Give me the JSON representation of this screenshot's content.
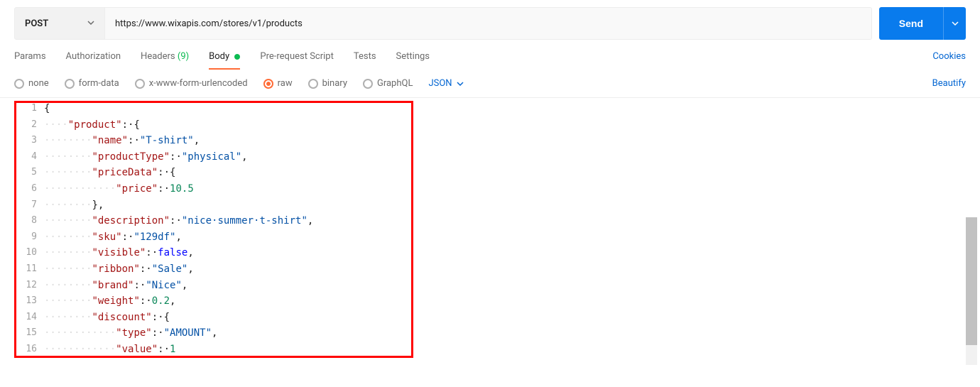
{
  "request": {
    "method": "POST",
    "url": "https://www.wixapis.com/stores/v1/products",
    "send_label": "Send"
  },
  "tabs": {
    "params": "Params",
    "authorization": "Authorization",
    "headers_label": "Headers",
    "headers_count": "(9)",
    "body": "Body",
    "prerequest": "Pre-request Script",
    "tests": "Tests",
    "settings": "Settings",
    "cookies": "Cookies"
  },
  "body_types": {
    "none": "none",
    "formdata": "form-data",
    "urlencoded": "x-www-form-urlencoded",
    "raw": "raw",
    "binary": "binary",
    "graphql": "GraphQL",
    "json": "JSON",
    "beautify": "Beautify"
  },
  "code": {
    "lines": [
      {
        "n": "1",
        "tokens": [
          {
            "t": "punct",
            "v": "{"
          }
        ]
      },
      {
        "n": "2",
        "tokens": [
          {
            "t": "guide",
            "v": "····"
          },
          {
            "t": "key",
            "v": "\"product\""
          },
          {
            "t": "punct",
            "v": ":·"
          },
          {
            "t": "punct",
            "v": "{"
          }
        ]
      },
      {
        "n": "3",
        "tokens": [
          {
            "t": "guide",
            "v": "········"
          },
          {
            "t": "key",
            "v": "\"name\""
          },
          {
            "t": "punct",
            "v": ":·"
          },
          {
            "t": "str",
            "v": "\"T-shirt\""
          },
          {
            "t": "punct",
            "v": ","
          }
        ]
      },
      {
        "n": "4",
        "tokens": [
          {
            "t": "guide",
            "v": "········"
          },
          {
            "t": "key",
            "v": "\"productType\""
          },
          {
            "t": "punct",
            "v": ":·"
          },
          {
            "t": "str",
            "v": "\"physical\""
          },
          {
            "t": "punct",
            "v": ","
          }
        ]
      },
      {
        "n": "5",
        "tokens": [
          {
            "t": "guide",
            "v": "········"
          },
          {
            "t": "key",
            "v": "\"priceData\""
          },
          {
            "t": "punct",
            "v": ":·"
          },
          {
            "t": "punct",
            "v": "{"
          }
        ]
      },
      {
        "n": "6",
        "tokens": [
          {
            "t": "guide",
            "v": "············"
          },
          {
            "t": "key",
            "v": "\"price\""
          },
          {
            "t": "punct",
            "v": ":·"
          },
          {
            "t": "num",
            "v": "10.5"
          }
        ]
      },
      {
        "n": "7",
        "tokens": [
          {
            "t": "guide",
            "v": "········"
          },
          {
            "t": "punct",
            "v": "},"
          }
        ]
      },
      {
        "n": "8",
        "tokens": [
          {
            "t": "guide",
            "v": "········"
          },
          {
            "t": "key",
            "v": "\"description\""
          },
          {
            "t": "punct",
            "v": ":·"
          },
          {
            "t": "str",
            "v": "\"nice·summer·t-shirt\""
          },
          {
            "t": "punct",
            "v": ","
          }
        ]
      },
      {
        "n": "9",
        "tokens": [
          {
            "t": "guide",
            "v": "········"
          },
          {
            "t": "key",
            "v": "\"sku\""
          },
          {
            "t": "punct",
            "v": ":·"
          },
          {
            "t": "str",
            "v": "\"129df\""
          },
          {
            "t": "punct",
            "v": ","
          }
        ]
      },
      {
        "n": "10",
        "tokens": [
          {
            "t": "guide",
            "v": "········"
          },
          {
            "t": "key",
            "v": "\"visible\""
          },
          {
            "t": "punct",
            "v": ":·"
          },
          {
            "t": "kw",
            "v": "false"
          },
          {
            "t": "punct",
            "v": ","
          }
        ]
      },
      {
        "n": "11",
        "tokens": [
          {
            "t": "guide",
            "v": "········"
          },
          {
            "t": "key",
            "v": "\"ribbon\""
          },
          {
            "t": "punct",
            "v": ":·"
          },
          {
            "t": "str",
            "v": "\"Sale\""
          },
          {
            "t": "punct",
            "v": ","
          }
        ]
      },
      {
        "n": "12",
        "tokens": [
          {
            "t": "guide",
            "v": "········"
          },
          {
            "t": "key",
            "v": "\"brand\""
          },
          {
            "t": "punct",
            "v": ":·"
          },
          {
            "t": "str",
            "v": "\"Nice\""
          },
          {
            "t": "punct",
            "v": ","
          }
        ]
      },
      {
        "n": "13",
        "tokens": [
          {
            "t": "guide",
            "v": "········"
          },
          {
            "t": "key",
            "v": "\"weight\""
          },
          {
            "t": "punct",
            "v": ":·"
          },
          {
            "t": "num",
            "v": "0.2"
          },
          {
            "t": "punct",
            "v": ","
          }
        ]
      },
      {
        "n": "14",
        "tokens": [
          {
            "t": "guide",
            "v": "········"
          },
          {
            "t": "key",
            "v": "\"discount\""
          },
          {
            "t": "punct",
            "v": ":·"
          },
          {
            "t": "punct",
            "v": "{"
          }
        ]
      },
      {
        "n": "15",
        "tokens": [
          {
            "t": "guide",
            "v": "············"
          },
          {
            "t": "key",
            "v": "\"type\""
          },
          {
            "t": "punct",
            "v": ":·"
          },
          {
            "t": "str",
            "v": "\"AMOUNT\""
          },
          {
            "t": "punct",
            "v": ","
          }
        ]
      },
      {
        "n": "16",
        "tokens": [
          {
            "t": "guide",
            "v": "············"
          },
          {
            "t": "key",
            "v": "\"value\""
          },
          {
            "t": "punct",
            "v": ":·"
          },
          {
            "t": "num",
            "v": "1"
          }
        ]
      }
    ]
  }
}
